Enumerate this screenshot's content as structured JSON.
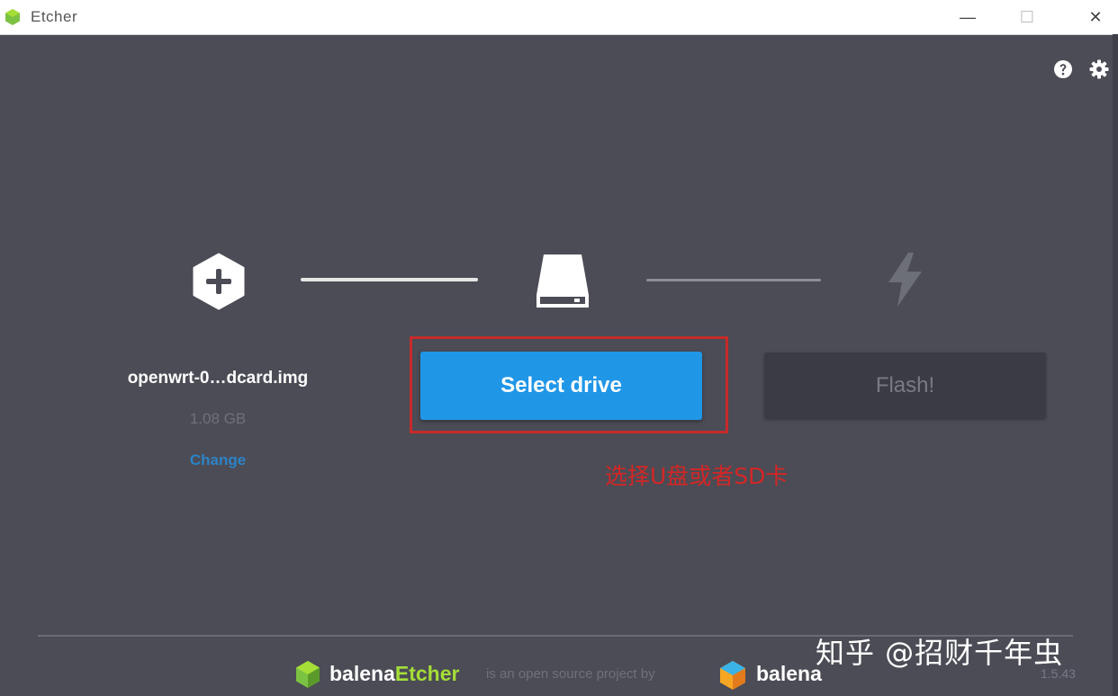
{
  "window": {
    "title": "Etcher",
    "minimize": "—",
    "maximize": "☐",
    "close": "✕"
  },
  "header": {
    "help_icon": "question-circle-icon",
    "settings_icon": "gear-icon"
  },
  "steps": {
    "image": {
      "icon": "plus-hexagon-icon",
      "filename": "openwrt-0…dcard.img",
      "size": "1.08 GB",
      "change_label": "Change"
    },
    "drive": {
      "icon": "drive-icon",
      "button_label": "Select drive"
    },
    "flash": {
      "icon": "lightning-bolt-icon",
      "button_label": "Flash!"
    }
  },
  "annotation": {
    "text": "选择U盘或者SD卡",
    "color": "#d42626"
  },
  "footer": {
    "etcher_brand_main": "balena",
    "etcher_brand_accent": "Etcher",
    "tagline": "is an open source project by",
    "balena_brand": "balena",
    "version": "1.5.43"
  },
  "watermark": "知乎 @招财千年虫",
  "colors": {
    "background": "#4b4c55",
    "primary_button": "#2096e7",
    "link": "#2c83c7",
    "etcher_accent": "#a5de37",
    "annotation_border": "#c62a2a"
  }
}
